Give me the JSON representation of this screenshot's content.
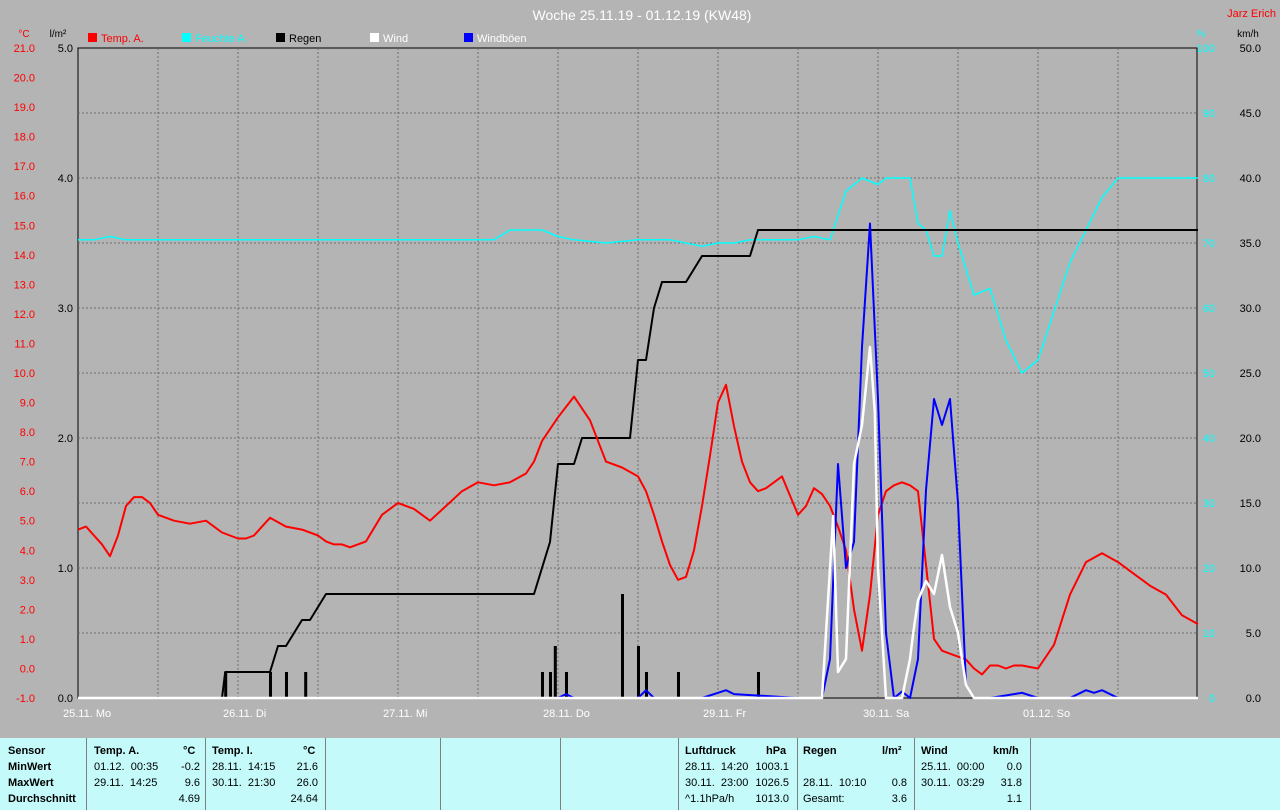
{
  "title": "Woche 25.11.19 - 01.12.19 (KW48)",
  "author": "Jarz Erich",
  "colors": {
    "background": "#b4b4b4",
    "temp": "#ff0000",
    "pressure": "#00ffff",
    "rain": "#000000",
    "wind": "#ffffff",
    "gust": "#0000ff",
    "stats_background": "#c4fafa"
  },
  "chart_data": {
    "type": "line",
    "title": "Woche 25.11.19 - 01.12.19 (KW48)",
    "grid": true,
    "legend_position": "top",
    "x_ticks": [
      "25.11. Mo",
      "26.11. Di",
      "27.11. Mi",
      "28.11. Do",
      "29.11. Fr",
      "30.11. Sa",
      "01.12. So"
    ],
    "axes": {
      "temp": {
        "unit": "°C",
        "range": [
          -1.0,
          21.0
        ],
        "ticks": [
          "21.0",
          "20.0",
          "19.0",
          "18.0",
          "17.0",
          "16.0",
          "15.0",
          "14.0",
          "13.0",
          "12.0",
          "11.0",
          "10.0",
          "9.0",
          "8.0",
          "7.0",
          "6.0",
          "5.0",
          "4.0",
          "3.0",
          "2.0",
          "1.0",
          "0.0",
          "-1.0"
        ]
      },
      "rain": {
        "unit": "l/m²",
        "range": [
          0.0,
          5.0
        ],
        "ticks": [
          "5.0",
          "4.0",
          "3.0",
          "2.0",
          "1.0",
          "0.0"
        ]
      },
      "pressure": {
        "unit": "%",
        "range": [
          0,
          100
        ],
        "ticks": [
          "100",
          "90",
          "80",
          "70",
          "60",
          "50",
          "40",
          "30",
          "20",
          "10",
          "0"
        ]
      },
      "wind": {
        "unit": "km/h",
        "range": [
          0.0,
          50.0
        ],
        "ticks": [
          "50.0",
          "45.0",
          "40.0",
          "35.0",
          "30.0",
          "25.0",
          "20.0",
          "15.0",
          "10.0",
          "5.0",
          "0.0"
        ]
      }
    },
    "series": [
      {
        "name": "Temp. A.",
        "axis": "temp",
        "x": [
          0,
          0.05,
          0.1,
          0.15,
          0.2,
          0.25,
          0.3,
          0.35,
          0.4,
          0.45,
          0.5,
          0.6,
          0.7,
          0.8,
          0.9,
          1.0,
          1.05,
          1.1,
          1.15,
          1.2,
          1.3,
          1.4,
          1.5,
          1.55,
          1.6,
          1.65,
          1.7,
          1.8,
          1.9,
          2.0,
          2.1,
          2.2,
          2.3,
          2.4,
          2.5,
          2.6,
          2.7,
          2.8,
          2.85,
          2.9,
          3.0,
          3.1,
          3.2,
          3.3,
          3.4,
          3.5,
          3.55,
          3.6,
          3.65,
          3.7,
          3.75,
          3.8,
          3.85,
          3.9,
          3.95,
          4.0,
          4.05,
          4.1,
          4.15,
          4.2,
          4.25,
          4.3,
          4.4,
          4.5,
          4.55,
          4.6,
          4.65,
          4.7,
          4.75,
          4.8,
          4.85,
          4.9,
          4.95,
          5.0,
          5.05,
          5.1,
          5.15,
          5.2,
          5.25,
          5.3,
          5.35,
          5.4,
          5.45,
          5.5,
          5.55,
          5.6,
          5.65,
          5.7,
          5.75,
          5.8,
          5.85,
          5.9,
          6.0,
          6.1,
          6.2,
          6.3,
          6.4,
          6.5,
          6.6,
          6.7,
          6.8,
          6.9,
          7.0
        ],
        "values": [
          4.7,
          4.8,
          4.5,
          4.2,
          3.8,
          4.5,
          5.5,
          5.8,
          5.8,
          5.6,
          5.2,
          5.0,
          4.9,
          5.0,
          4.6,
          4.4,
          4.4,
          4.5,
          4.8,
          5.1,
          4.8,
          4.7,
          4.5,
          4.3,
          4.2,
          4.2,
          4.1,
          4.3,
          5.2,
          5.6,
          5.4,
          5.0,
          5.5,
          6.0,
          6.3,
          6.2,
          6.3,
          6.6,
          7.0,
          7.7,
          8.5,
          9.2,
          8.4,
          7.0,
          6.8,
          6.5,
          6.0,
          5.2,
          4.3,
          3.5,
          3.0,
          3.1,
          4.0,
          5.5,
          7.2,
          9.0,
          9.6,
          8.2,
          7.0,
          6.3,
          6.0,
          6.1,
          6.5,
          5.2,
          5.5,
          6.1,
          5.9,
          5.5,
          4.8,
          4.0,
          2.0,
          0.6,
          2.5,
          5.2,
          6.0,
          6.2,
          6.3,
          6.2,
          6.0,
          3.5,
          1.0,
          0.6,
          0.5,
          0.4,
          0.3,
          0.0,
          -0.2,
          0.1,
          0.1,
          0.0,
          0.1,
          0.1,
          0.0,
          0.8,
          2.5,
          3.6,
          3.9,
          3.6,
          3.2,
          2.8,
          2.5,
          1.8,
          1.5
        ]
      },
      {
        "name": "Feuchte A.",
        "axis": "pressure",
        "x": [
          0,
          0.1,
          0.2,
          0.3,
          0.5,
          1.0,
          1.5,
          2.0,
          2.3,
          2.4,
          2.5,
          2.6,
          2.7,
          2.9,
          3.0,
          3.1,
          3.3,
          3.5,
          3.7,
          3.9,
          4.0,
          4.1,
          4.2,
          4.3,
          4.4,
          4.5,
          4.6,
          4.7,
          4.8,
          4.9,
          5.0,
          5.05,
          5.1,
          5.15,
          5.2,
          5.25,
          5.3,
          5.35,
          5.4,
          5.45,
          5.5,
          5.6,
          5.7,
          5.8,
          5.9,
          6.0,
          6.2,
          6.4,
          6.5,
          6.55,
          6.6,
          6.65,
          6.7,
          6.8,
          6.9,
          7.0
        ],
        "values": [
          70.5,
          70.5,
          71,
          70.5,
          70.5,
          70.5,
          70.5,
          70.5,
          70.5,
          70.5,
          70.5,
          70.5,
          72,
          72,
          71,
          70.5,
          70,
          70.5,
          70.5,
          69.5,
          70,
          70,
          70.5,
          70.5,
          70.5,
          70.5,
          71,
          70.5,
          78,
          80,
          79,
          80,
          80,
          80,
          80,
          73,
          72,
          68,
          68,
          75,
          70,
          62,
          63,
          55,
          50,
          52,
          67,
          77,
          80,
          80,
          80,
          80,
          80,
          80,
          80,
          80
        ]
      },
      {
        "name": "Regen",
        "axis": "rain",
        "x": [
          0,
          0.9,
          0.92,
          1.0,
          1.2,
          1.25,
          1.3,
          1.4,
          1.45,
          1.55,
          1.6,
          1.7,
          2.0,
          2.5,
          2.7,
          2.85,
          2.9,
          2.95,
          3.0,
          3.05,
          3.1,
          3.15,
          3.2,
          3.4,
          3.45,
          3.5,
          3.55,
          3.6,
          3.65,
          3.7,
          3.75,
          3.8,
          3.9,
          4.0,
          4.1,
          4.2,
          4.25,
          4.3,
          4.4,
          4.5,
          4.6,
          4.65,
          4.7,
          4.8,
          5.0,
          5.5,
          6.0,
          6.5,
          7.0
        ],
        "values": [
          0.0,
          0.0,
          0.2,
          0.2,
          0.2,
          0.4,
          0.4,
          0.6,
          0.6,
          0.8,
          0.8,
          0.8,
          0.8,
          0.8,
          0.8,
          0.8,
          1.0,
          1.2,
          1.8,
          1.8,
          1.8,
          2.0,
          2.0,
          2.0,
          2.0,
          2.6,
          2.6,
          3.0,
          3.2,
          3.2,
          3.2,
          3.2,
          3.4,
          3.4,
          3.4,
          3.4,
          3.6,
          3.6,
          3.6,
          3.6,
          3.6,
          3.6,
          3.6,
          3.6,
          3.6,
          3.6,
          3.6,
          3.6,
          3.6
        ]
      },
      {
        "name": "Regen Balken",
        "axis": "rain",
        "x": [
          0.92,
          1.2,
          1.3,
          1.42,
          2.9,
          2.95,
          2.98,
          3.05,
          3.4,
          3.5,
          3.55,
          3.75,
          4.25
        ],
        "values": [
          0.2,
          0.2,
          0.2,
          0.2,
          0.2,
          0.2,
          0.4,
          0.2,
          0.8,
          0.4,
          0.2,
          0.2,
          0.2
        ]
      },
      {
        "name": "Wind",
        "axis": "wind",
        "x": [
          0,
          4.6,
          4.65,
          4.7,
          4.72,
          4.75,
          4.8,
          4.85,
          4.9,
          4.95,
          4.98,
          5.0,
          5.05,
          5.1,
          5.15,
          5.2,
          5.22,
          5.25,
          5.3,
          5.35,
          5.4,
          5.45,
          5.5,
          5.55,
          5.6,
          5.65,
          5.7,
          6.0,
          7.0
        ],
        "values": [
          0,
          0,
          0,
          10.0,
          14.0,
          2.0,
          3.0,
          18.0,
          21.0,
          27.0,
          22.0,
          10.0,
          0,
          0,
          0,
          3.0,
          5.0,
          7.5,
          9.0,
          8.0,
          11.0,
          7.0,
          5.0,
          1.0,
          0,
          0,
          0,
          0,
          0
        ]
      },
      {
        "name": "Windböen",
        "axis": "wind",
        "x": [
          0,
          3.0,
          3.05,
          3.1,
          3.5,
          3.55,
          3.6,
          3.9,
          4.0,
          4.05,
          4.1,
          4.5,
          4.6,
          4.65,
          4.7,
          4.75,
          4.8,
          4.85,
          4.9,
          4.95,
          5.0,
          5.05,
          5.1,
          5.15,
          5.2,
          5.25,
          5.3,
          5.35,
          5.4,
          5.45,
          5.5,
          5.55,
          5.6,
          5.7,
          5.9,
          6.0,
          6.1,
          6.2,
          6.3,
          6.35,
          6.4,
          6.5,
          7.0
        ],
        "values": [
          0,
          0,
          0.3,
          0,
          0,
          0.6,
          0,
          0,
          0.4,
          0.6,
          0.3,
          0,
          0,
          0,
          3.0,
          18.0,
          10.0,
          12.0,
          27.0,
          36.5,
          23.0,
          5.0,
          0,
          0.5,
          0,
          3.0,
          16.0,
          23.0,
          21.0,
          23.0,
          15.0,
          1.0,
          0,
          0,
          0.4,
          0,
          0,
          0,
          0.6,
          0.4,
          0.6,
          0,
          0
        ]
      }
    ]
  },
  "stats": {
    "sensor": {
      "header": "Sensor",
      "rows": [
        "MinWert",
        "MaxWert",
        "Durchschnitt"
      ]
    },
    "temp_a": {
      "header": "Temp. A.",
      "unit": "°C",
      "min": {
        "date": "01.12.  00:35",
        "value": "-0.2"
      },
      "max": {
        "date": "29.11.  14:25",
        "value": "9.6"
      },
      "avg": "4.69"
    },
    "temp_i": {
      "header": "Temp. I.",
      "unit": "°C",
      "min": {
        "date": "28.11.  14:15",
        "value": "21.6"
      },
      "max": {
        "date": "30.11.  21:30",
        "value": "26.0"
      },
      "avg": "24.64"
    },
    "luftdruck": {
      "header": "Luftdruck",
      "unit": "hPa",
      "min": {
        "date": "28.11.  14:20",
        "value": "1003.1"
      },
      "max": {
        "date": "30.11.  23:00",
        "value": "1026.5"
      },
      "avg": {
        "date": "^1.1hPa/h",
        "value": "1013.0"
      }
    },
    "regen": {
      "header": "Regen",
      "unit": "l/m²",
      "max": {
        "date": "28.11.  10:10",
        "value": "0.8"
      },
      "total": {
        "date": "Gesamt:",
        "value": "3.6"
      }
    },
    "wind": {
      "header": "Wind",
      "unit": "km/h",
      "min": {
        "date": "25.11.  00:00",
        "value": "0.0"
      },
      "max": {
        "date": "30.11.  03:29",
        "value": "31.8"
      },
      "avg": "1.1"
    }
  }
}
